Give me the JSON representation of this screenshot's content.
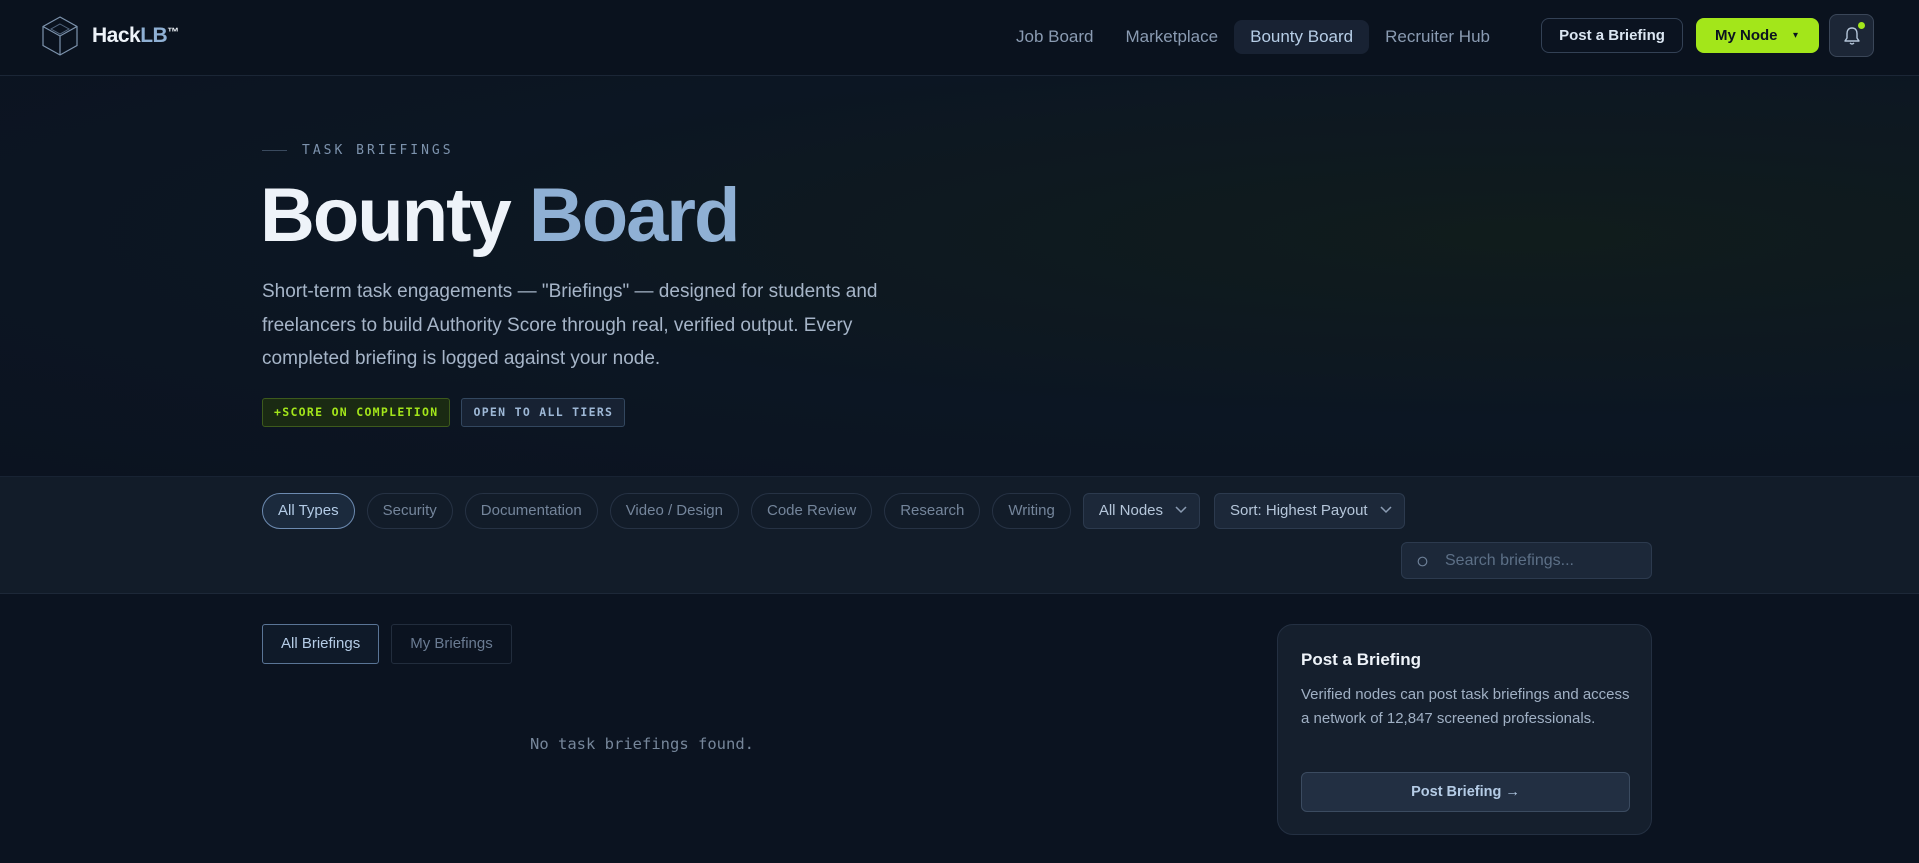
{
  "brand": {
    "name_main": "Hack",
    "name_accent": "LB",
    "trademark": "™"
  },
  "nav": {
    "items": [
      {
        "label": "Job Board",
        "active": false
      },
      {
        "label": "Marketplace",
        "active": false
      },
      {
        "label": "Bounty Board",
        "active": true
      },
      {
        "label": "Recruiter Hub",
        "active": false
      }
    ]
  },
  "header": {
    "post_button": "Post a Briefing",
    "node_button": "My Node",
    "node_caret": "▾",
    "notification_dot_color": "#a3e61a"
  },
  "hero": {
    "eyebrow": "TASK BRIEFINGS",
    "title_main": "Bounty",
    "title_accent": "Board",
    "description": "Short-term task engagements — \"Briefings\" — designed for students and freelancers to build Authority Score through real, verified output. Every completed briefing is logged against your node.",
    "tags": [
      "+SCORE ON COMPLETION",
      "OPEN TO ALL TIERS"
    ]
  },
  "filters": {
    "types": [
      {
        "label": "All Types",
        "active": true
      },
      {
        "label": "Security",
        "active": false
      },
      {
        "label": "Documentation",
        "active": false
      },
      {
        "label": "Video / Design",
        "active": false
      },
      {
        "label": "Code Review",
        "active": false
      },
      {
        "label": "Research",
        "active": false
      },
      {
        "label": "Writing",
        "active": false
      }
    ],
    "node_select": "All Nodes",
    "sort_select": "Sort: Highest Payout",
    "search_placeholder": "Search briefings..."
  },
  "tabs": [
    {
      "label": "All Briefings",
      "active": true
    },
    {
      "label": "My Briefings",
      "active": false
    }
  ],
  "empty_state": "No task briefings found.",
  "post_card": {
    "title": "Post a Briefing",
    "text": "Verified nodes can post task briefings and access a network of 12,847 screened professionals.",
    "button": "Post Briefing →"
  },
  "colors": {
    "background": "#0b1320",
    "accent_lime": "#a3e61a",
    "accent_blue": "#8fb0d4"
  }
}
